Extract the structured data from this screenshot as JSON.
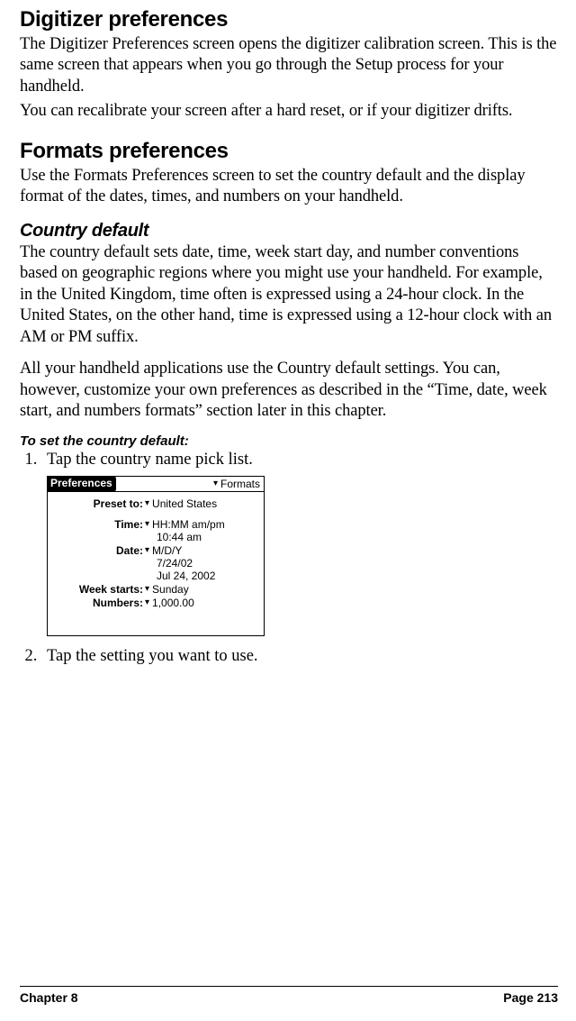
{
  "section1": {
    "heading": "Digitizer preferences",
    "p1": "The Digitizer Preferences screen opens the digitizer calibration screen. This is the same screen that appears when you go through the Setup process for your handheld.",
    "p2": "You can recalibrate your screen after a hard reset, or if your digitizer drifts."
  },
  "section2": {
    "heading": "Formats preferences",
    "p1": "Use the Formats Preferences screen to set the country default and the display format of the dates, times, and numbers on your handheld."
  },
  "section3": {
    "heading": "Country default",
    "p1": "The country default sets date, time, week start day, and number conventions based on geographic regions where you might use your handheld. For example, in the United Kingdom, time often is expressed using a 24-hour clock. In the United States, on the other hand, time is expressed using a 12-hour clock with an AM or PM suffix.",
    "p2": "All your handheld applications use the Country default settings. You can, however, customize your own preferences as described in the “Time, date, week start, and numbers formats” section later in this chapter."
  },
  "howto": {
    "heading": "To set the country default:",
    "step1": "Tap the country name pick list.",
    "step2": "Tap the setting you want to use."
  },
  "screenshot": {
    "titleLeft": "Preferences",
    "titleRight": "Formats",
    "rows": {
      "preset": {
        "label": "Preset to:",
        "value": "United States"
      },
      "time": {
        "label": "Time:",
        "value": "HH:MM am/pm",
        "sub": "10:44 am"
      },
      "date": {
        "label": "Date:",
        "value": "M/D/Y",
        "sub1": "7/24/02",
        "sub2": "Jul 24, 2002"
      },
      "week": {
        "label": "Week starts:",
        "value": "Sunday"
      },
      "numbers": {
        "label": "Numbers:",
        "value": "1,000.00"
      }
    }
  },
  "footer": {
    "left": "Chapter 8",
    "right": "Page 213"
  }
}
